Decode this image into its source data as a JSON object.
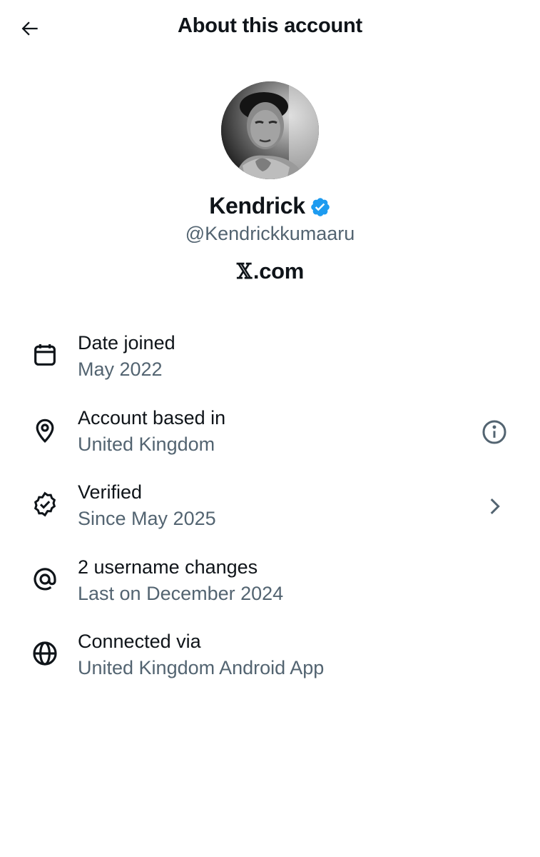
{
  "header": {
    "title": "About this account",
    "back_icon": "arrow-left-icon"
  },
  "profile": {
    "display_name": "Kendrick",
    "handle": "@Kendrickkumaaru",
    "verified": true,
    "badge_color": "#1d9bf0",
    "domain_mark": "𝕏",
    "domain_suffix": ".com"
  },
  "details": [
    {
      "icon": "calendar-icon",
      "title": "Date joined",
      "subtitle": "May 2022"
    },
    {
      "icon": "location-pin-icon",
      "title": "Account based in",
      "subtitle": "United Kingdom",
      "action_icon": "info-circle-icon"
    },
    {
      "icon": "verified-check-icon",
      "title": "Verified",
      "subtitle": "Since May 2025",
      "action_icon": "chevron-right-icon"
    },
    {
      "icon": "at-sign-icon",
      "title": "2 username changes",
      "subtitle": "Last on December 2024"
    },
    {
      "icon": "globe-icon",
      "title": "Connected via",
      "subtitle": "United Kingdom Android App"
    }
  ],
  "colors": {
    "text_primary": "#0f1419",
    "text_secondary": "#536471",
    "accent": "#1d9bf0",
    "background": "#ffffff"
  }
}
